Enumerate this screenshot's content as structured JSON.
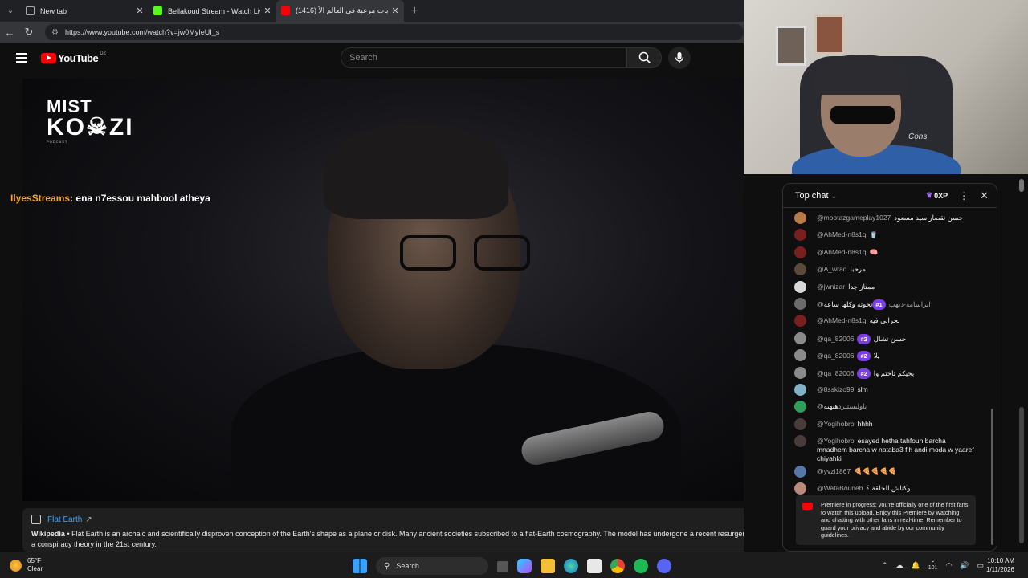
{
  "browser": {
    "tabs": [
      {
        "title": "New tab",
        "active": false,
        "color": "#5f6368"
      },
      {
        "title": "Bellakoud Stream - Watch Live on",
        "active": false,
        "color": "#53fc18"
      },
      {
        "title": "نظريات مرعبة في العالم الأ (1416)",
        "active": true,
        "color": "#ff0000"
      }
    ],
    "url": "https://www.youtube.com/watch?v=jw0MyIeUI_s"
  },
  "youtube": {
    "logo_text": "YouTube",
    "country_code": "DZ",
    "search_placeholder": "Search"
  },
  "video": {
    "channel_logo_line1": "MIST",
    "channel_logo_line2": "KO☠ZI",
    "channel_logo_line3": "PODCAST",
    "overlay_user": "IlyesStreams",
    "overlay_message": ": ena n7essou mahbool atheya"
  },
  "info_panel": {
    "title": "Flat Earth",
    "source": "Wikipedia",
    "text": " • Flat Earth is an archaic and scientifically disproven conception of the Earth's shape as a plane or disk. Many ancient societies subscribed to a flat-Earth cosmography. The model has undergone a recent resurgence as a conspiracy theory in the 21st century."
  },
  "webcam": {
    "overlay_text": "Cons"
  },
  "chat": {
    "mode_label": "Top chat",
    "xp_label": "0XP",
    "messages": [
      {
        "user": "@mootazgameplay1027",
        "text": "حسن تقصار سيد مسعود",
        "badge": "",
        "avatar": "#b77b4a"
      },
      {
        "user": "@AhMed-n8s1q",
        "text": "🥤",
        "badge": "",
        "avatar": "#7a1f1f"
      },
      {
        "user": "@AhMed-n8s1q",
        "text": "🧠",
        "badge": "",
        "avatar": "#7a1f1f"
      },
      {
        "user": "@A_wraq",
        "text": "مرحبا",
        "badge": "",
        "avatar": "#5b4a3a"
      },
      {
        "user": "@jwnizar",
        "text": "ممتاز جدا",
        "badge": "",
        "avatar": "#d8d8d8"
      },
      {
        "user": "@ابراسامه-ديهب",
        "text": "نخوته وكلها ساعه",
        "badge": "#1",
        "avatar": "#6b6b6b"
      },
      {
        "user": "@AhMed-n8s1q",
        "text": "نحرابي فيه",
        "badge": "",
        "avatar": "#7a1f1f"
      },
      {
        "user": "@qa_82006",
        "text": "حسن تشال",
        "badge": "#2",
        "avatar": "#8a8a8a"
      },
      {
        "user": "@qa_82006",
        "text": "يلا",
        "badge": "#2",
        "avatar": "#8a8a8a"
      },
      {
        "user": "@qa_82006",
        "text": "بحيكم تاختم وا",
        "badge": "#2",
        "avatar": "#8a8a8a"
      },
      {
        "user": "@8sskizo99",
        "text": "slm",
        "badge": "",
        "avatar": "#7fb2c9"
      },
      {
        "user": "@ياوليستيرد",
        "text": "هيهيه",
        "badge": "",
        "avatar": "#2e9e5b"
      },
      {
        "user": "@Yogihobro",
        "text": "hhhh",
        "badge": "",
        "avatar": "#4a3b3b"
      },
      {
        "user": "@Yogihobro",
        "text": "esayed hetha tahfoun barcha mnadhem barcha w nataba3 fih andi moda w yaaref chiyahki",
        "badge": "",
        "avatar": "#4a3b3b"
      },
      {
        "user": "@yvzi1867",
        "text": "🍕🍕🍕🍕🍕",
        "badge": "",
        "avatar": "#5577aa"
      },
      {
        "user": "@WafaBouneb",
        "text": "وكتاش الحلقة ؟",
        "badge": "",
        "avatar": "#b98a7a"
      }
    ],
    "premiere_notice": "Premiere in progress: you're officially one of the first fans to watch this upload. Enjoy this Premiere by watching and chatting with other fans in real-time. Remember to guard your privacy and abide by our community guidelines."
  },
  "taskbar": {
    "temperature": "65°F",
    "condition": "Clear",
    "search_label": "Search",
    "lang_line1": "ع",
    "lang_line2": "101",
    "time": "10:10 AM",
    "date": "1/11/2026"
  }
}
